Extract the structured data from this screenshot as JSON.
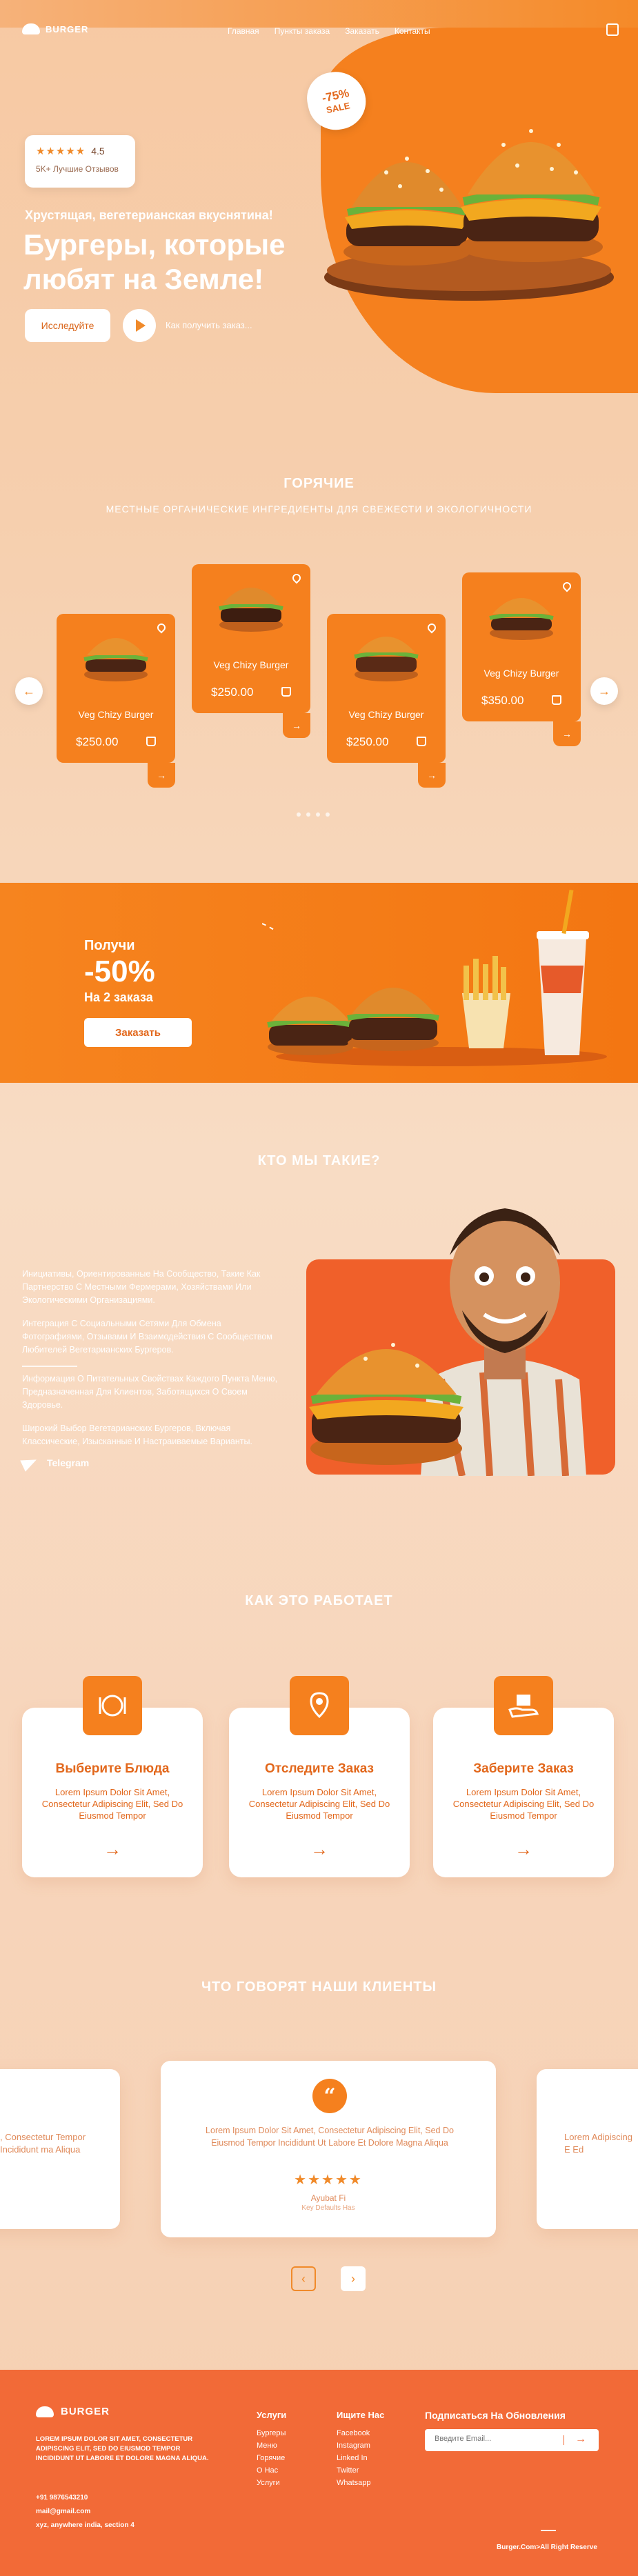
{
  "header": {
    "logo": "BURGER",
    "menu": [
      "Главная",
      "Пункты заказа",
      "Заказать",
      "Контакты"
    ]
  },
  "hero": {
    "rating": "4.5",
    "stars": "★★★★★",
    "reviews": "5K+ Лучшие Отзывов",
    "kicker": "Хрустящая, вегетерианская вкуснятина!",
    "title_line1": "Бургеры, которые",
    "title_line2": "любят на Земле!",
    "explore_btn": "Исследуйте",
    "how_to_order": "Как получить заказ...",
    "sale_percent": "-75%",
    "sale_word": "SALE"
  },
  "hot": {
    "title": "ГОРЯЧИЕ",
    "subtitle": "МЕСТНЫЕ ОРГАНИЧЕСКИЕ ИНГРЕДИЕНТЫ ДЛЯ СВЕЖЕСТИ И ЭКОЛОГИЧНОСТИ",
    "products": [
      {
        "name": "Veg Chizy Burger",
        "price": "$250.00"
      },
      {
        "name": "Veg Chizy Burger",
        "price": "$250.00"
      },
      {
        "name": "Veg Chizy Burger",
        "price": "$250.00"
      },
      {
        "name": "Veg Chizy Burger",
        "price": "$350.00"
      }
    ],
    "arrow_prev": "←",
    "arrow_next": "→"
  },
  "promo": {
    "label": "Получи",
    "discount": "-50%",
    "sub": "На 2 заказа",
    "button": "Заказать"
  },
  "about": {
    "title": "КТО МЫ ТАКИЕ?",
    "p1": "Инициативы, Ориентированные На Сообщество, Такие Как Партнерство С Местными Фермерами, Хозяйствами Или Экологическими Организациями.",
    "p2": "Интеграция С Социальными Сетями Для Обмена Фотографиями, Отзывами И Взаимодействия С Сообществом Любителей Вегетарианских Бургеров.",
    "p3": "Информация О Питательных Свойствах Каждого Пункта Меню, Предназначенная Для Клиентов, Заботящихся О Своем Здоровье.",
    "p4": "Широкий Выбор Вегетарианских Бургеров, Включая Классические, Изысканные И Настраиваемые Варианты.",
    "telegram": "Telegram"
  },
  "how": {
    "title": "КАК ЭТО РАБОТАЕТ",
    "steps": [
      {
        "title": "Выберите Блюда",
        "text": "Lorem Ipsum Dolor Sit Amet, Consectetur Adipiscing Elit, Sed Do Eiusmod Tempor",
        "arrow": "→"
      },
      {
        "title": "Отследите Заказ",
        "text": "Lorem Ipsum Dolor Sit Amet, Consectetur Adipiscing Elit, Sed Do Eiusmod Tempor",
        "arrow": "→"
      },
      {
        "title": "Заберите Заказ",
        "text": "Lorem Ipsum Dolor Sit Amet, Consectetur Adipiscing Elit, Sed Do Eiusmod Tempor",
        "arrow": "→"
      }
    ]
  },
  "testimonials": {
    "title": "ЧТО ГОВОРЯТ НАШИ КЛИЕНТЫ",
    "main": {
      "text": "Lorem Ipsum Dolor Sit Amet, Consectetur Adipiscing Elit, Sed Do Eiusmod Tempor Incididunt Ut Labore Et Dolore Magna Aliqua",
      "stars": "★★★★★",
      "name": "Ayubat Fi",
      "role": "Key Defaults Has"
    },
    "left_fragment": ", Consectetur Tempor Incididunt ma Aliqua",
    "right_fragment": "Lorem Adipiscing E Ed",
    "prev": "‹",
    "next": "›"
  },
  "footer": {
    "logo": "BURGER",
    "about": "LOREM IPSUM DOLOR SIT AMET, CONSECTETUR ADIPISCING ELIT, SED DO EIUSMOD TEMPOR INCIDIDUNT UT LABORE ET DOLORE MAGNA ALIQUA.",
    "phone": "+91 9876543210",
    "email": "mail@gmail.com",
    "address": "xyz, anywhere india, section 4",
    "services_title": "Услуги",
    "services": [
      "Бургеры",
      "Меню",
      "Горячие",
      "О Нас",
      "Услуги"
    ],
    "find_title": "Ищите Нас",
    "find": [
      "Facebook",
      "Instagram",
      "Linked In",
      "Twitter",
      "Whatsapp"
    ],
    "subscribe_title": "Подписаться На Обновления",
    "email_placeholder": "Введите Email...",
    "go": "→",
    "copyright": "Burger.Com>All Right Reserve"
  },
  "colors": {
    "accent": "#f5801e",
    "footer": "#f26a37",
    "about_card": "#f0602a"
  }
}
